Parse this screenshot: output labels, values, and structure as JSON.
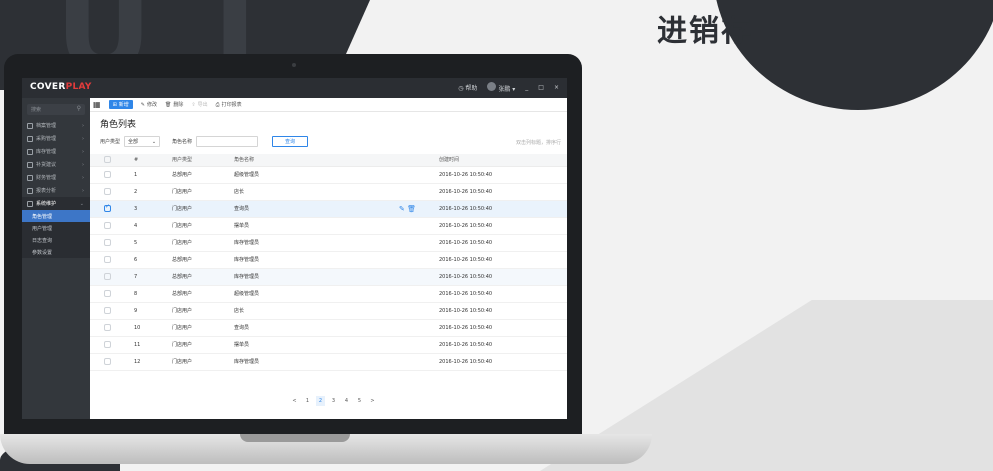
{
  "banner": {
    "title": "进销存"
  },
  "app": {
    "logo_a": "COVER",
    "logo_b": "PLAY",
    "topbar": {
      "help": "帮助",
      "user": "张鹏",
      "minimize": "_",
      "maximize": "□",
      "close": "×"
    }
  },
  "sidebar": {
    "search_placeholder": "搜索",
    "items": [
      {
        "label": "档案管理"
      },
      {
        "label": "采购管理"
      },
      {
        "label": "库存管理"
      },
      {
        "label": "补货建议"
      },
      {
        "label": "财务管理"
      },
      {
        "label": "报表分析"
      },
      {
        "label": "系统维护"
      }
    ],
    "subitems": [
      {
        "label": "角色管理"
      },
      {
        "label": "用户管理"
      },
      {
        "label": "日志查询"
      },
      {
        "label": "参数设置"
      }
    ]
  },
  "toolbar": {
    "new": "新增",
    "edit": "修改",
    "delete": "删除",
    "export": "导出",
    "print": "打印报表"
  },
  "page": {
    "heading": "角色列表",
    "filter_type_label": "用户类型",
    "filter_type_value": "全部",
    "filter_name_label": "角色名称",
    "query_button": "查询",
    "hint": "双击列标题，排序行"
  },
  "table": {
    "headers": [
      "",
      "#",
      "用户类型",
      "角色名称",
      "",
      "创建时间"
    ],
    "rows": [
      {
        "n": "1",
        "type": "总部用户",
        "name": "超级管理员",
        "time": "2016-10-26  10:50:40"
      },
      {
        "n": "2",
        "type": "门店用户",
        "name": "店长",
        "time": "2016-10-26  10:50:40"
      },
      {
        "n": "3",
        "type": "门店用户",
        "name": "查询员",
        "time": "2016-10-26  10:50:40"
      },
      {
        "n": "4",
        "type": "门店用户",
        "name": "摆单员",
        "time": "2016-10-26  10:50:40"
      },
      {
        "n": "5",
        "type": "门店用户",
        "name": "库存管理员",
        "time": "2016-10-26  10:50:40"
      },
      {
        "n": "6",
        "type": "总部用户",
        "name": "库存管理员",
        "time": "2016-10-26  10:50:40"
      },
      {
        "n": "7",
        "type": "总部用户",
        "name": "库存管理员",
        "time": "2016-10-26  10:50:40"
      },
      {
        "n": "8",
        "type": "总部用户",
        "name": "超级管理员",
        "time": "2016-10-26  10:50:40"
      },
      {
        "n": "9",
        "type": "门店用户",
        "name": "店长",
        "time": "2016-10-26  10:50:40"
      },
      {
        "n": "10",
        "type": "门店用户",
        "name": "查询员",
        "time": "2016-10-26  10:50:40"
      },
      {
        "n": "11",
        "type": "门店用户",
        "name": "摆单员",
        "time": "2016-10-26  10:50:40"
      },
      {
        "n": "12",
        "type": "门店用户",
        "name": "库存管理员",
        "time": "2016-10-26  10:50:40"
      }
    ]
  },
  "pager": {
    "prev": "<",
    "pages": [
      "1",
      "2",
      "3",
      "4",
      "5"
    ],
    "next": ">"
  },
  "colors": {
    "accent": "#2f86e8",
    "sidebar": "#33373c",
    "topbar": "#2b2e33",
    "logo_red": "#e23b3b",
    "active_menu": "#3d76c7"
  }
}
